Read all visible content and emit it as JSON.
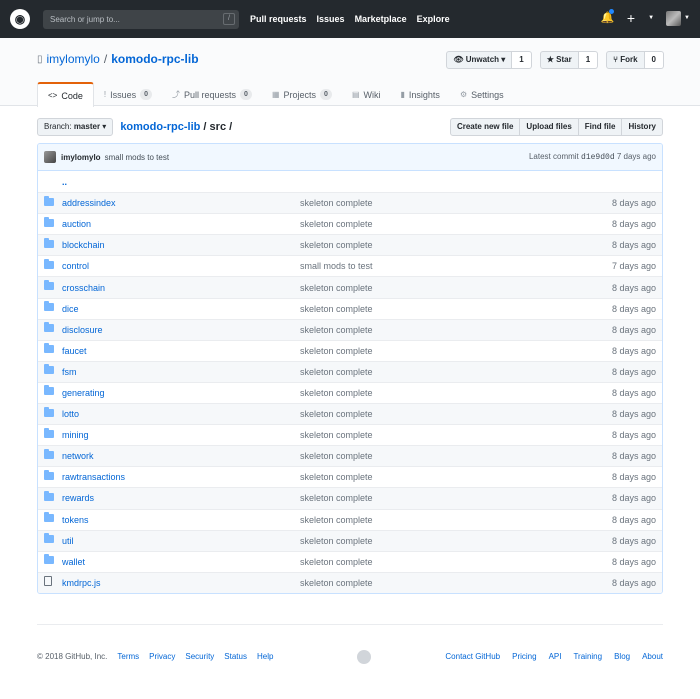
{
  "header": {
    "search_placeholder": "Search or jump to...",
    "search_key": "/",
    "nav": [
      "Pull requests",
      "Issues",
      "Marketplace",
      "Explore"
    ]
  },
  "repo": {
    "owner": "imylomylo",
    "name": "komodo-rpc-lib",
    "watch_label": "Unwatch",
    "watch_count": "1",
    "star_label": "Star",
    "star_count": "1",
    "fork_label": "Fork",
    "fork_count": "0"
  },
  "tabs": [
    {
      "label": "Code",
      "icon": "<>"
    },
    {
      "label": "Issues",
      "icon": "!",
      "count": "0"
    },
    {
      "label": "Pull requests",
      "icon": "⤴",
      "count": "0"
    },
    {
      "label": "Projects",
      "icon": "▦",
      "count": "0"
    },
    {
      "label": "Wiki",
      "icon": "▤"
    },
    {
      "label": "Insights",
      "icon": "▮"
    },
    {
      "label": "Settings",
      "icon": "⚙"
    }
  ],
  "toolbar": {
    "branch_prefix": "Branch:",
    "branch": "master",
    "crumb_repo": "komodo-rpc-lib",
    "crumb_path": " / src /",
    "buttons": [
      "Create new file",
      "Upload files",
      "Find file",
      "History"
    ]
  },
  "commit": {
    "author": "imylomylo",
    "message": "small mods to test",
    "latest_label": "Latest commit",
    "sha": "d1e9d0d",
    "age": "7 days ago"
  },
  "parent_dir": "..",
  "files": [
    {
      "name": "addressindex",
      "type": "dir",
      "message": "skeleton complete",
      "age": "8 days ago"
    },
    {
      "name": "auction",
      "type": "dir",
      "message": "skeleton complete",
      "age": "8 days ago"
    },
    {
      "name": "blockchain",
      "type": "dir",
      "message": "skeleton complete",
      "age": "8 days ago"
    },
    {
      "name": "control",
      "type": "dir",
      "message": "small mods to test",
      "age": "7 days ago"
    },
    {
      "name": "crosschain",
      "type": "dir",
      "message": "skeleton complete",
      "age": "8 days ago"
    },
    {
      "name": "dice",
      "type": "dir",
      "message": "skeleton complete",
      "age": "8 days ago"
    },
    {
      "name": "disclosure",
      "type": "dir",
      "message": "skeleton complete",
      "age": "8 days ago"
    },
    {
      "name": "faucet",
      "type": "dir",
      "message": "skeleton complete",
      "age": "8 days ago"
    },
    {
      "name": "fsm",
      "type": "dir",
      "message": "skeleton complete",
      "age": "8 days ago"
    },
    {
      "name": "generating",
      "type": "dir",
      "message": "skeleton complete",
      "age": "8 days ago"
    },
    {
      "name": "lotto",
      "type": "dir",
      "message": "skeleton complete",
      "age": "8 days ago"
    },
    {
      "name": "mining",
      "type": "dir",
      "message": "skeleton complete",
      "age": "8 days ago"
    },
    {
      "name": "network",
      "type": "dir",
      "message": "skeleton complete",
      "age": "8 days ago"
    },
    {
      "name": "rawtransactions",
      "type": "dir",
      "message": "skeleton complete",
      "age": "8 days ago"
    },
    {
      "name": "rewards",
      "type": "dir",
      "message": "skeleton complete",
      "age": "8 days ago"
    },
    {
      "name": "tokens",
      "type": "dir",
      "message": "skeleton complete",
      "age": "8 days ago"
    },
    {
      "name": "util",
      "type": "dir",
      "message": "skeleton complete",
      "age": "8 days ago"
    },
    {
      "name": "wallet",
      "type": "dir",
      "message": "skeleton complete",
      "age": "8 days ago"
    },
    {
      "name": "kmdrpc.js",
      "type": "file",
      "message": "skeleton complete",
      "age": "8 days ago"
    }
  ],
  "footer": {
    "copyright": "© 2018 GitHub, Inc.",
    "left_links": [
      "Terms",
      "Privacy",
      "Security",
      "Status",
      "Help"
    ],
    "right_links": [
      "Contact GitHub",
      "Pricing",
      "API",
      "Training",
      "Blog",
      "About"
    ]
  }
}
